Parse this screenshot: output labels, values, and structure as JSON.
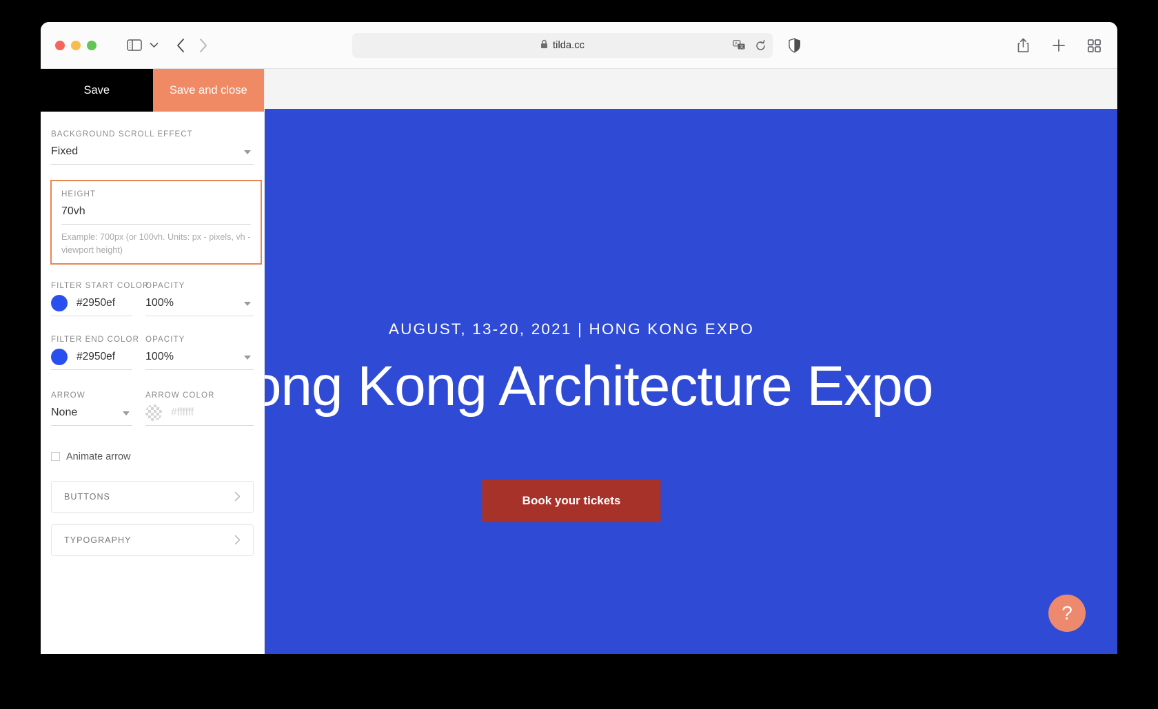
{
  "browser": {
    "url": "tilda.cc",
    "icons": {
      "sidebar_toggle": "sidebar-toggle-icon",
      "sidebar_chevron": "chevron-down-icon",
      "back": "back-arrow-icon",
      "forward": "forward-arrow-icon",
      "lock": "lock-icon",
      "translate": "translate-icon",
      "reload": "reload-icon",
      "shield": "privacy-shield-icon",
      "share": "share-icon",
      "new_tab": "plus-icon",
      "tab_overview": "tab-overview-icon"
    }
  },
  "panel": {
    "save_label": "Save",
    "save_close_label": "Save and close",
    "scroll_effect": {
      "label": "Background scroll effect",
      "value": "Fixed"
    },
    "height": {
      "label": "Height",
      "value": "70vh",
      "hint": "Example: 700px (or 100vh. Units: px - pixels, vh - viewport height)",
      "highlight_color": "#e8854f"
    },
    "filter_start": {
      "label": "Filter start color",
      "hex": "#2950ef",
      "swatch": "#2950ef",
      "opacity_label": "Opacity",
      "opacity_value": "100%"
    },
    "filter_end": {
      "label": "Filter end color",
      "hex": "#2950ef",
      "swatch": "#2950ef",
      "opacity_label": "Opacity",
      "opacity_value": "100%"
    },
    "arrow": {
      "label": "Arrow",
      "value": "None",
      "color_label": "Arrow color",
      "color_placeholder": "#ffffff"
    },
    "animate_arrow": {
      "label": "Animate arrow",
      "checked": false
    },
    "accordions": [
      {
        "label": "Buttons"
      },
      {
        "label": "Typography"
      }
    ]
  },
  "hero": {
    "eyebrow": "AUGUST, 13-20, 2021 | HONG KONG EXPO",
    "title": "Hong Kong Architecture Expo",
    "cta_label": "Book your tickets",
    "background_color": "#2f4bd6",
    "cta_color": "#a7322a",
    "help_label": "?"
  }
}
